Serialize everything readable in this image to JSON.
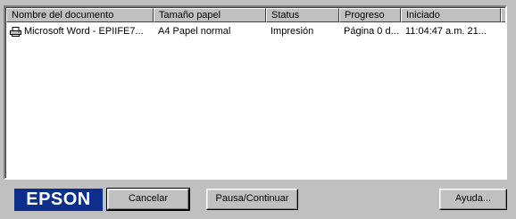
{
  "columns": [
    "Nombre del documento",
    "Tamaño papel",
    "Status",
    "Progreso",
    "Iniciado"
  ],
  "jobs": [
    {
      "document": "Microsoft Word - EPIIFE7...",
      "paper_size": "A4 Papel normal",
      "status": "Impresión",
      "progress": "Página 0 d...",
      "started": "11:04:47 a.m. 21..."
    }
  ],
  "brand": "EPSON",
  "buttons": {
    "cancel": "Cancelar",
    "pause": "Pausa/Continuar",
    "help": "Ayuda..."
  },
  "icons": {
    "job": "printer-icon"
  },
  "colors": {
    "brand_bg": "#0b2f8a",
    "window_bg": "#c0c0c0"
  }
}
